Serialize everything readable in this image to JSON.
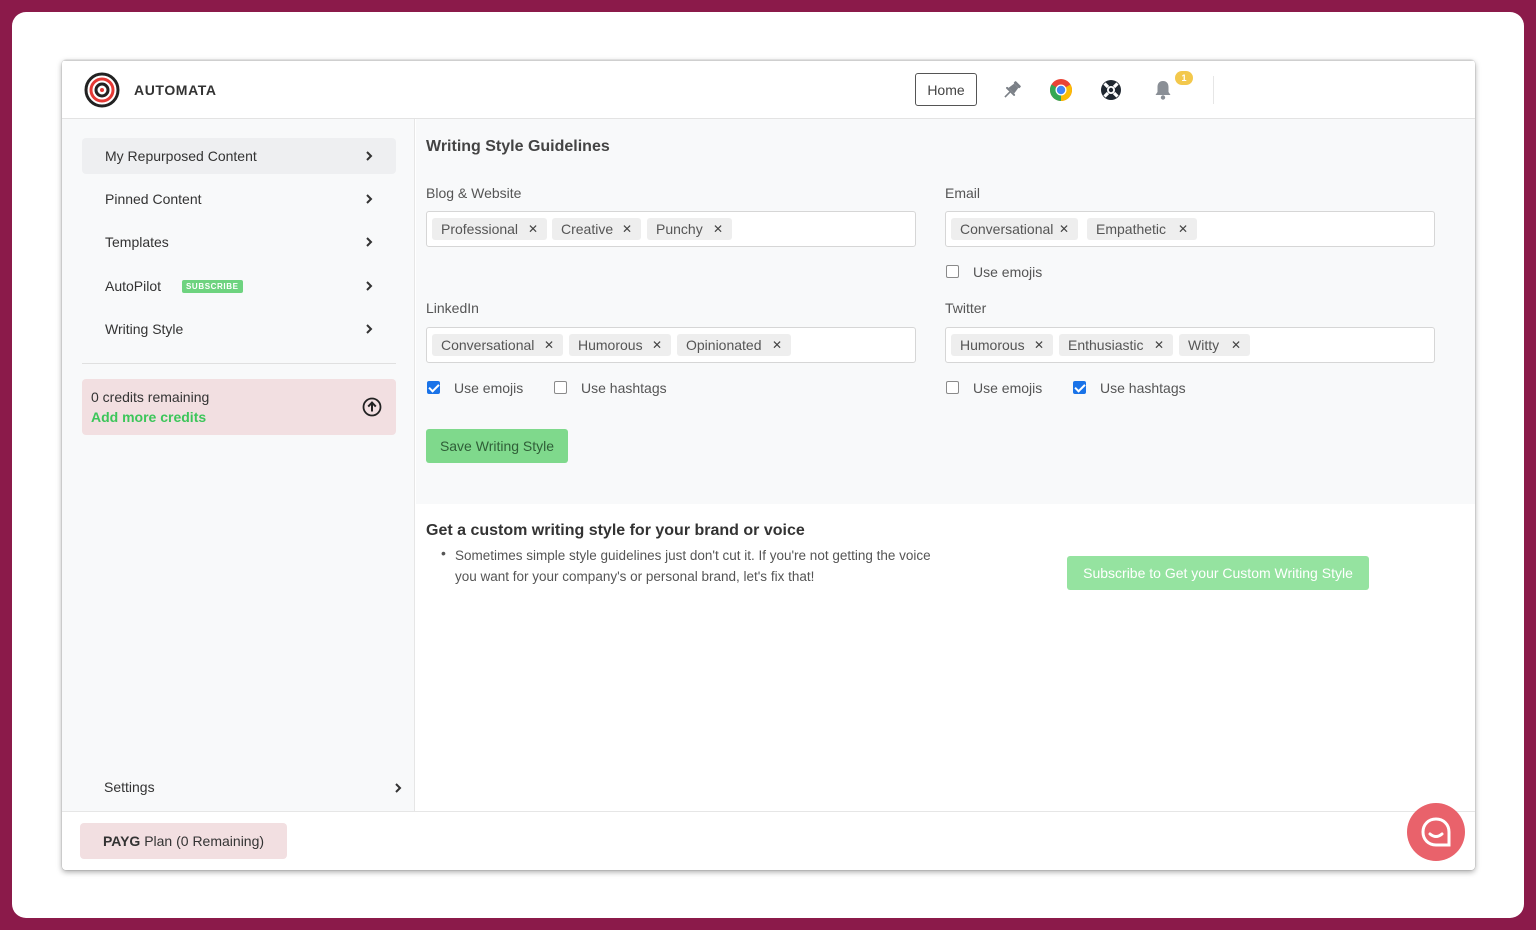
{
  "header": {
    "brand": "AUTOMATA",
    "home_label": "Home",
    "notification_count": "1",
    "icons": [
      "target-logo-icon",
      "pin-icon",
      "chrome-icon",
      "lifebuoy-icon",
      "bell-icon"
    ]
  },
  "sidebar": {
    "items": [
      {
        "label": "My Repurposed Content"
      },
      {
        "label": "Pinned Content"
      },
      {
        "label": "Templates"
      },
      {
        "label": "AutoPilot",
        "badge": "SUBSCRIBE"
      },
      {
        "label": "Writing Style"
      }
    ],
    "credits": {
      "text": "0 credits remaining",
      "link": "Add more credits"
    },
    "settings_label": "Settings"
  },
  "footer": {
    "plan_bold": "PAYG",
    "plan_rest": " Plan (0 Remaining)"
  },
  "main": {
    "title": "Writing Style Guidelines",
    "blog": {
      "label": "Blog & Website",
      "tags": [
        "Professional",
        "Creative",
        "Punchy"
      ]
    },
    "email": {
      "label": "Email",
      "tags": [
        "Conversational",
        "Empathetic"
      ],
      "use_emojis_label": "Use emojis",
      "use_emojis": false
    },
    "linkedin": {
      "label": "LinkedIn",
      "tags": [
        "Conversational",
        "Humorous",
        "Opinionated"
      ],
      "use_emojis_label": "Use emojis",
      "use_emojis": true,
      "use_hashtags_label": "Use hashtags",
      "use_hashtags": false
    },
    "twitter": {
      "label": "Twitter",
      "tags": [
        "Humorous",
        "Enthusiastic",
        "Witty"
      ],
      "use_emojis_label": "Use emojis",
      "use_emojis": false,
      "use_hashtags_label": "Use hashtags",
      "use_hashtags": true
    },
    "save_label": "Save Writing Style",
    "custom": {
      "title": "Get a custom writing style for your brand or voice",
      "bullet": "Sometimes simple style guidelines just don't cut it. If you're not getting the voice you want for your company's or personal brand, let's fix that!",
      "button": "Subscribe to Get your Custom Writing Style"
    }
  },
  "colors": {
    "page_background": "#8b1a4a",
    "accent_green": "#7fd98c",
    "credits_link": "#3cc65a",
    "credits_bg": "#f2dfe1",
    "chat_button": "#e9626b",
    "checkbox_on": "#1a73e8"
  }
}
